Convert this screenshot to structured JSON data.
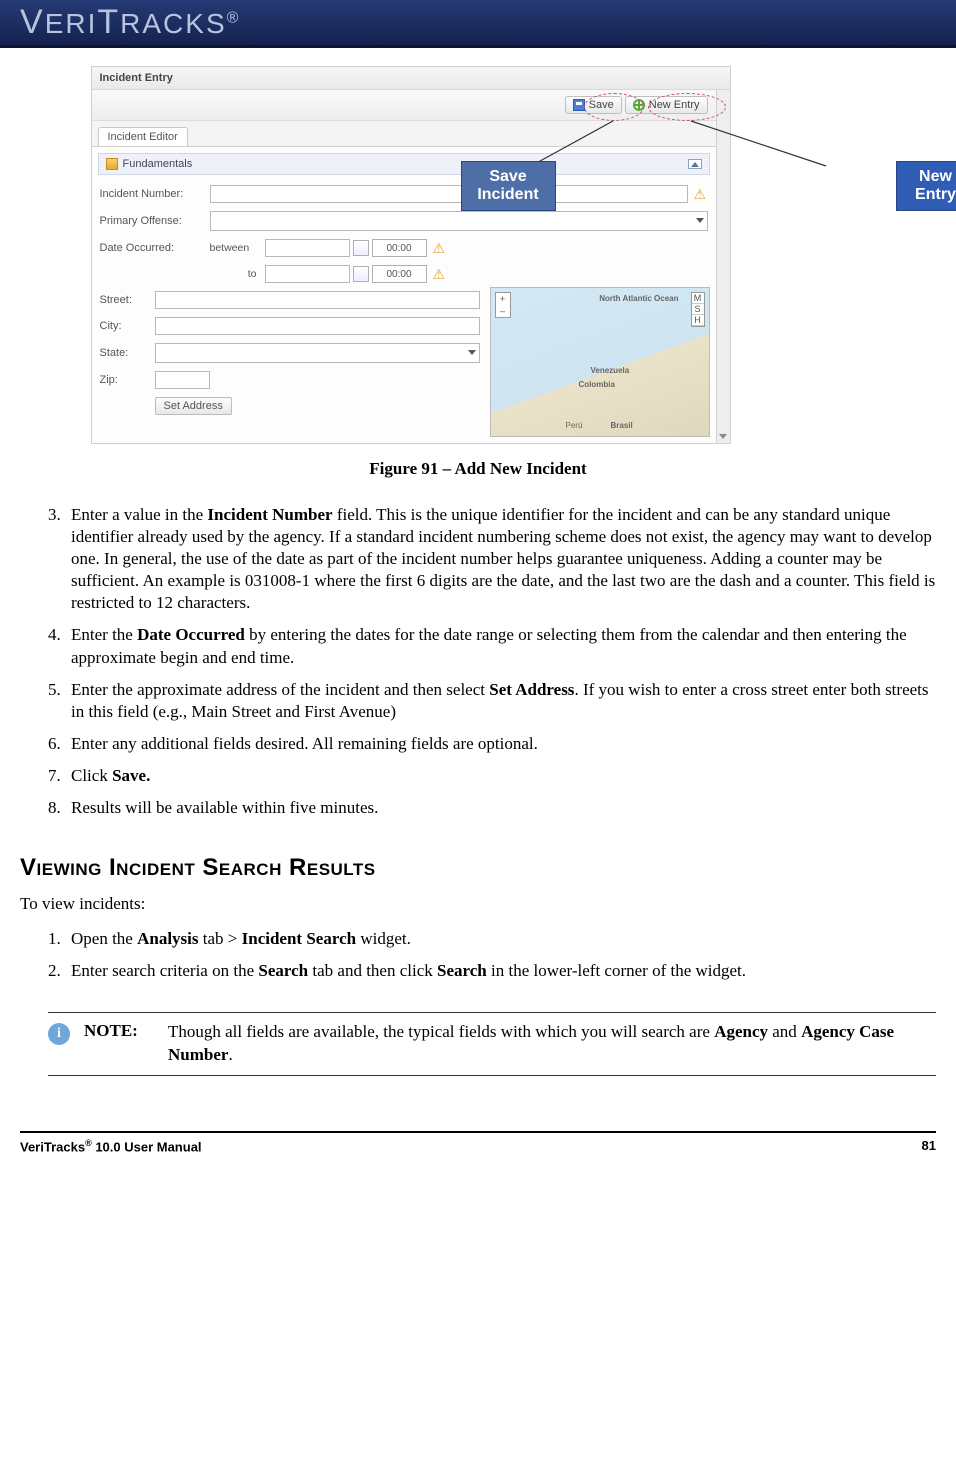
{
  "header": {
    "logo_text": "VERITRACKS",
    "logo_reg": "®"
  },
  "screenshot": {
    "window_title": "Incident Entry",
    "toolbar": {
      "save": "Save",
      "new_entry": "New Entry"
    },
    "tab": "Incident Editor",
    "section": "Fundamentals",
    "labels": {
      "incident_number": "Incident Number:",
      "primary_offense": "Primary Offense:",
      "date_occurred": "Date Occurred:",
      "between": "between",
      "to": "to",
      "time1": "00:00",
      "time2": "00:00",
      "street": "Street:",
      "city": "City:",
      "state": "State:",
      "zip": "Zip:",
      "set_address": "Set Address"
    },
    "map_labels": {
      "na": "North Atlantic Ocean",
      "ven": "Venezuela",
      "col": "Colombia",
      "bra": "Brasil",
      "per": "Perú"
    },
    "map_ctrls": {
      "m": "M",
      "s": "S",
      "h": "H",
      "plus": "+",
      "minus": "–"
    }
  },
  "callouts": {
    "save": "Save Incident",
    "new": "New Entry"
  },
  "figure_caption": "Figure 91 – Add New Incident",
  "steps_a": [
    {
      "n": "3",
      "pre": "Enter a value in the ",
      "b": "Incident Number",
      "post": " field. This is the unique identifier for the incident and can be any standard unique identifier already used by the agency. If a standard incident numbering scheme does not exist, the agency may want to develop one. In general, the use of the date as part of the incident number helps guarantee uniqueness. Adding a counter may be sufficient. An example is 031008-1 where the first 6 digits are the date, and the last two are the dash and a counter. This field is restricted to 12 characters."
    },
    {
      "n": "4",
      "pre": "Enter the ",
      "b": "Date Occurred",
      "post": " by entering the dates for the date range or selecting them from the calendar and then entering the approximate begin and end time."
    },
    {
      "n": "5",
      "pre": "Enter the approximate address of the incident and then select ",
      "b": "Set Address",
      "post": ". If you wish to enter a cross street enter both streets in this field (e.g., Main Street and First Avenue)"
    },
    {
      "n": "6",
      "pre": "Enter any additional fields desired. All remaining fields are optional.",
      "b": "",
      "post": ""
    },
    {
      "n": "7",
      "pre": "Click ",
      "b": "Save.",
      "post": ""
    },
    {
      "n": "8",
      "pre": "Results will be available within five minutes.",
      "b": "",
      "post": ""
    }
  ],
  "section2": {
    "heading": "Viewing Incident Search Results",
    "intro": "To view incidents:",
    "steps": [
      {
        "n": "1",
        "segs": [
          {
            "t": "Open the "
          },
          {
            "t": "Analysis",
            "b": true
          },
          {
            "t": " tab > "
          },
          {
            "t": "Incident Search",
            "b": true
          },
          {
            "t": " widget."
          }
        ]
      },
      {
        "n": "2",
        "segs": [
          {
            "t": "Enter search criteria on the "
          },
          {
            "t": "Search",
            "b": true
          },
          {
            "t": " tab and then click "
          },
          {
            "t": "Search",
            "b": true
          },
          {
            "t": " in the lower-left corner of the widget."
          }
        ]
      }
    ],
    "note_label": "NOTE:",
    "note_segs": [
      {
        "t": "Though all fields are available, the typical fields with which you will search are "
      },
      {
        "t": "Agency",
        "b": true
      },
      {
        "t": " and "
      },
      {
        "t": "Agency Case Number",
        "b": true
      },
      {
        "t": "."
      }
    ]
  },
  "footer": {
    "left_pre": "VeriTracks",
    "left_sup": "®",
    "left_post": " 10.0 User Manual",
    "page": "81"
  }
}
